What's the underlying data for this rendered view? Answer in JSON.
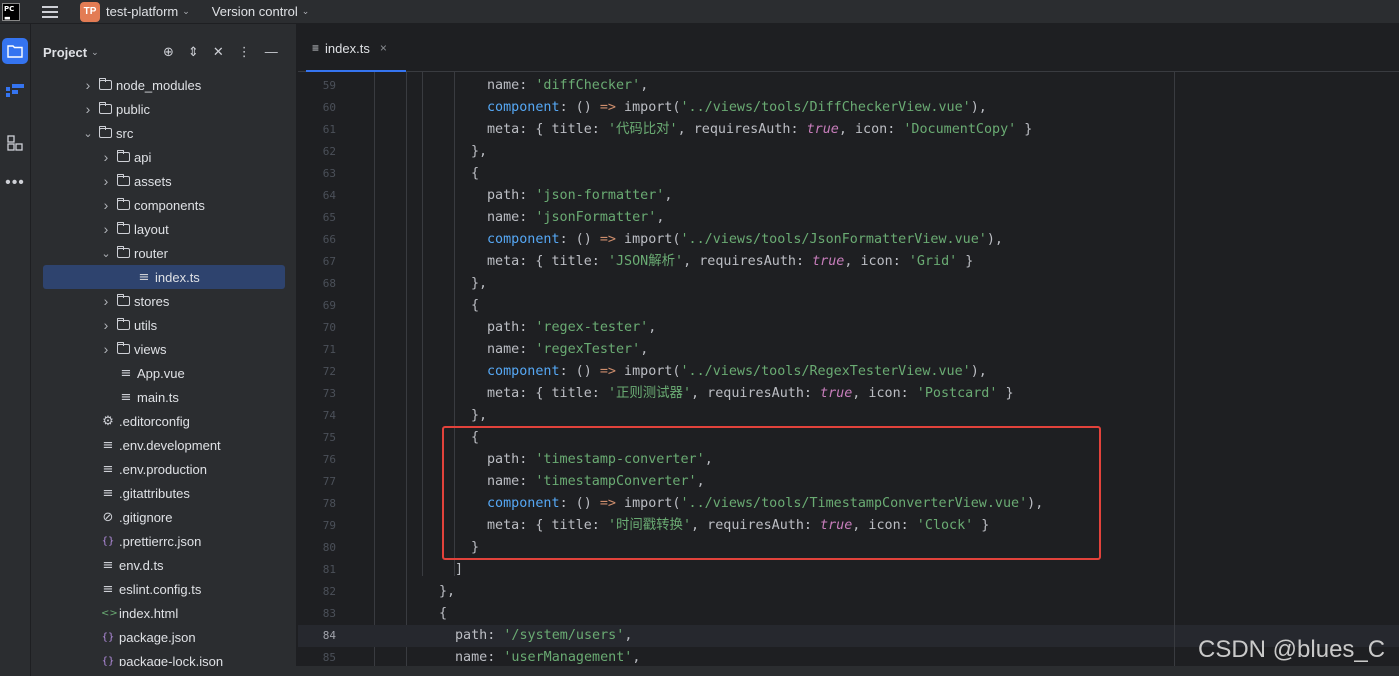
{
  "titlebar": {
    "project_badge": "TP",
    "project_name": "test-platform",
    "version_control": "Version control"
  },
  "project_panel": {
    "title": "Project"
  },
  "tree": [
    {
      "label": "node_modules",
      "type": "folder",
      "depth": 1,
      "expanded": false
    },
    {
      "label": "public",
      "type": "folder",
      "depth": 1,
      "expanded": false
    },
    {
      "label": "src",
      "type": "folder",
      "depth": 1,
      "expanded": true
    },
    {
      "label": "api",
      "type": "folder",
      "depth": 2,
      "expanded": false
    },
    {
      "label": "assets",
      "type": "folder",
      "depth": 2,
      "expanded": false
    },
    {
      "label": "components",
      "type": "folder",
      "depth": 2,
      "expanded": false
    },
    {
      "label": "layout",
      "type": "folder",
      "depth": 2,
      "expanded": false
    },
    {
      "label": "router",
      "type": "folder",
      "depth": 2,
      "expanded": true
    },
    {
      "label": "index.ts",
      "type": "file",
      "depth": 3,
      "selected": true,
      "icon": "lines-icon"
    },
    {
      "label": "stores",
      "type": "folder",
      "depth": 2,
      "expanded": false
    },
    {
      "label": "utils",
      "type": "folder",
      "depth": 2,
      "expanded": false
    },
    {
      "label": "views",
      "type": "folder",
      "depth": 2,
      "expanded": false
    },
    {
      "label": "App.vue",
      "type": "file",
      "depth": 2,
      "icon": "lines-icon"
    },
    {
      "label": "main.ts",
      "type": "file",
      "depth": 2,
      "icon": "lines-icon"
    },
    {
      "label": ".editorconfig",
      "type": "file",
      "depth": 1,
      "icon": "gear-icon"
    },
    {
      "label": ".env.development",
      "type": "file",
      "depth": 1,
      "icon": "lines-icon"
    },
    {
      "label": ".env.production",
      "type": "file",
      "depth": 1,
      "icon": "lines-icon"
    },
    {
      "label": ".gitattributes",
      "type": "file",
      "depth": 1,
      "icon": "lines-icon"
    },
    {
      "label": ".gitignore",
      "type": "file",
      "depth": 1,
      "icon": "ban-icon"
    },
    {
      "label": ".prettierrc.json",
      "type": "file",
      "depth": 1,
      "icon": "braces-icon"
    },
    {
      "label": "env.d.ts",
      "type": "file",
      "depth": 1,
      "icon": "lines-icon"
    },
    {
      "label": "eslint.config.ts",
      "type": "file",
      "depth": 1,
      "icon": "lines-icon"
    },
    {
      "label": "index.html",
      "type": "file",
      "depth": 1,
      "icon": "html-icon"
    },
    {
      "label": "package.json",
      "type": "file",
      "depth": 1,
      "icon": "braces-icon"
    },
    {
      "label": "package-lock.json",
      "type": "file",
      "depth": 1,
      "icon": "braces-icon"
    }
  ],
  "editor": {
    "tab_label": "index.ts",
    "tab_close": "×",
    "current_line": 84,
    "lines": [
      {
        "n": 59,
        "indent": 3,
        "tokens": [
          [
            "k",
            "name: "
          ],
          [
            "s",
            "'diffChecker'"
          ],
          [
            "p",
            ","
          ]
        ]
      },
      {
        "n": 60,
        "indent": 3,
        "tokens": [
          [
            "c",
            "component"
          ],
          [
            "p",
            ": () "
          ],
          [
            "w",
            "=>"
          ],
          [
            "p",
            " import("
          ],
          [
            "s",
            "'../views/tools/DiffCheckerView.vue'"
          ],
          [
            "p",
            "),"
          ]
        ]
      },
      {
        "n": 61,
        "indent": 3,
        "tokens": [
          [
            "k",
            "meta: { title: "
          ],
          [
            "s",
            "'代码比对'"
          ],
          [
            "p",
            ", requiresAuth: "
          ],
          [
            "t",
            "true"
          ],
          [
            "p",
            ", icon: "
          ],
          [
            "s",
            "'DocumentCopy'"
          ],
          [
            "p",
            " }"
          ]
        ]
      },
      {
        "n": 62,
        "indent": 2,
        "tokens": [
          [
            "p",
            "},"
          ]
        ]
      },
      {
        "n": 63,
        "indent": 2,
        "tokens": [
          [
            "p",
            "{"
          ]
        ]
      },
      {
        "n": 64,
        "indent": 3,
        "tokens": [
          [
            "k",
            "path: "
          ],
          [
            "s",
            "'json-formatter'"
          ],
          [
            "p",
            ","
          ]
        ]
      },
      {
        "n": 65,
        "indent": 3,
        "tokens": [
          [
            "k",
            "name: "
          ],
          [
            "s",
            "'jsonFormatter'"
          ],
          [
            "p",
            ","
          ]
        ]
      },
      {
        "n": 66,
        "indent": 3,
        "tokens": [
          [
            "c",
            "component"
          ],
          [
            "p",
            ": () "
          ],
          [
            "w",
            "=>"
          ],
          [
            "p",
            " import("
          ],
          [
            "s",
            "'../views/tools/JsonFormatterView.vue'"
          ],
          [
            "p",
            "),"
          ]
        ]
      },
      {
        "n": 67,
        "indent": 3,
        "tokens": [
          [
            "k",
            "meta: { title: "
          ],
          [
            "s",
            "'JSON解析'"
          ],
          [
            "p",
            ", requiresAuth: "
          ],
          [
            "t",
            "true"
          ],
          [
            "p",
            ", icon: "
          ],
          [
            "s",
            "'Grid'"
          ],
          [
            "p",
            " }"
          ]
        ]
      },
      {
        "n": 68,
        "indent": 2,
        "tokens": [
          [
            "p",
            "},"
          ]
        ]
      },
      {
        "n": 69,
        "indent": 2,
        "tokens": [
          [
            "p",
            "{"
          ]
        ]
      },
      {
        "n": 70,
        "indent": 3,
        "tokens": [
          [
            "k",
            "path: "
          ],
          [
            "s",
            "'regex-tester'"
          ],
          [
            "p",
            ","
          ]
        ]
      },
      {
        "n": 71,
        "indent": 3,
        "tokens": [
          [
            "k",
            "name: "
          ],
          [
            "s",
            "'regexTester'"
          ],
          [
            "p",
            ","
          ]
        ]
      },
      {
        "n": 72,
        "indent": 3,
        "tokens": [
          [
            "c",
            "component"
          ],
          [
            "p",
            ": () "
          ],
          [
            "w",
            "=>"
          ],
          [
            "p",
            " import("
          ],
          [
            "s",
            "'../views/tools/RegexTesterView.vue'"
          ],
          [
            "p",
            "),"
          ]
        ]
      },
      {
        "n": 73,
        "indent": 3,
        "tokens": [
          [
            "k",
            "meta: { title: "
          ],
          [
            "s",
            "'正则测试器'"
          ],
          [
            "p",
            ", requiresAuth: "
          ],
          [
            "t",
            "true"
          ],
          [
            "p",
            ", icon: "
          ],
          [
            "s",
            "'Postcard'"
          ],
          [
            "p",
            " }"
          ]
        ]
      },
      {
        "n": 74,
        "indent": 2,
        "tokens": [
          [
            "p",
            "},"
          ]
        ]
      },
      {
        "n": 75,
        "indent": 2,
        "tokens": [
          [
            "p",
            "{"
          ]
        ]
      },
      {
        "n": 76,
        "indent": 3,
        "tokens": [
          [
            "k",
            "path: "
          ],
          [
            "s",
            "'timestamp-converter'"
          ],
          [
            "p",
            ","
          ]
        ]
      },
      {
        "n": 77,
        "indent": 3,
        "tokens": [
          [
            "k",
            "name: "
          ],
          [
            "s",
            "'timestampConverter'"
          ],
          [
            "p",
            ","
          ]
        ]
      },
      {
        "n": 78,
        "indent": 3,
        "tokens": [
          [
            "c",
            "component"
          ],
          [
            "p",
            ": () "
          ],
          [
            "w",
            "=>"
          ],
          [
            "p",
            " import("
          ],
          [
            "s",
            "'../views/tools/TimestampConverterView.vue'"
          ],
          [
            "p",
            "),"
          ]
        ]
      },
      {
        "n": 79,
        "indent": 3,
        "tokens": [
          [
            "k",
            "meta: { title: "
          ],
          [
            "s",
            "'时间戳转换'"
          ],
          [
            "p",
            ", requiresAuth: "
          ],
          [
            "t",
            "true"
          ],
          [
            "p",
            ", icon: "
          ],
          [
            "s",
            "'Clock'"
          ],
          [
            "p",
            " }"
          ]
        ]
      },
      {
        "n": 80,
        "indent": 2,
        "tokens": [
          [
            "p",
            "}"
          ]
        ]
      },
      {
        "n": 81,
        "indent": 1,
        "tokens": [
          [
            "p",
            "]"
          ]
        ]
      },
      {
        "n": 82,
        "indent": 0,
        "tokens": [
          [
            "p",
            "},"
          ]
        ]
      },
      {
        "n": 83,
        "indent": 0,
        "tokens": [
          [
            "p",
            "{"
          ]
        ]
      },
      {
        "n": 84,
        "indent": 1,
        "tokens": [
          [
            "k",
            "path: "
          ],
          [
            "s",
            "'/system/users'"
          ],
          [
            "p",
            ","
          ]
        ]
      },
      {
        "n": 85,
        "indent": 1,
        "tokens": [
          [
            "k",
            "name: "
          ],
          [
            "s",
            "'userManagement'"
          ],
          [
            "p",
            ","
          ]
        ]
      }
    ]
  },
  "watermark": "CSDN @blues_C"
}
